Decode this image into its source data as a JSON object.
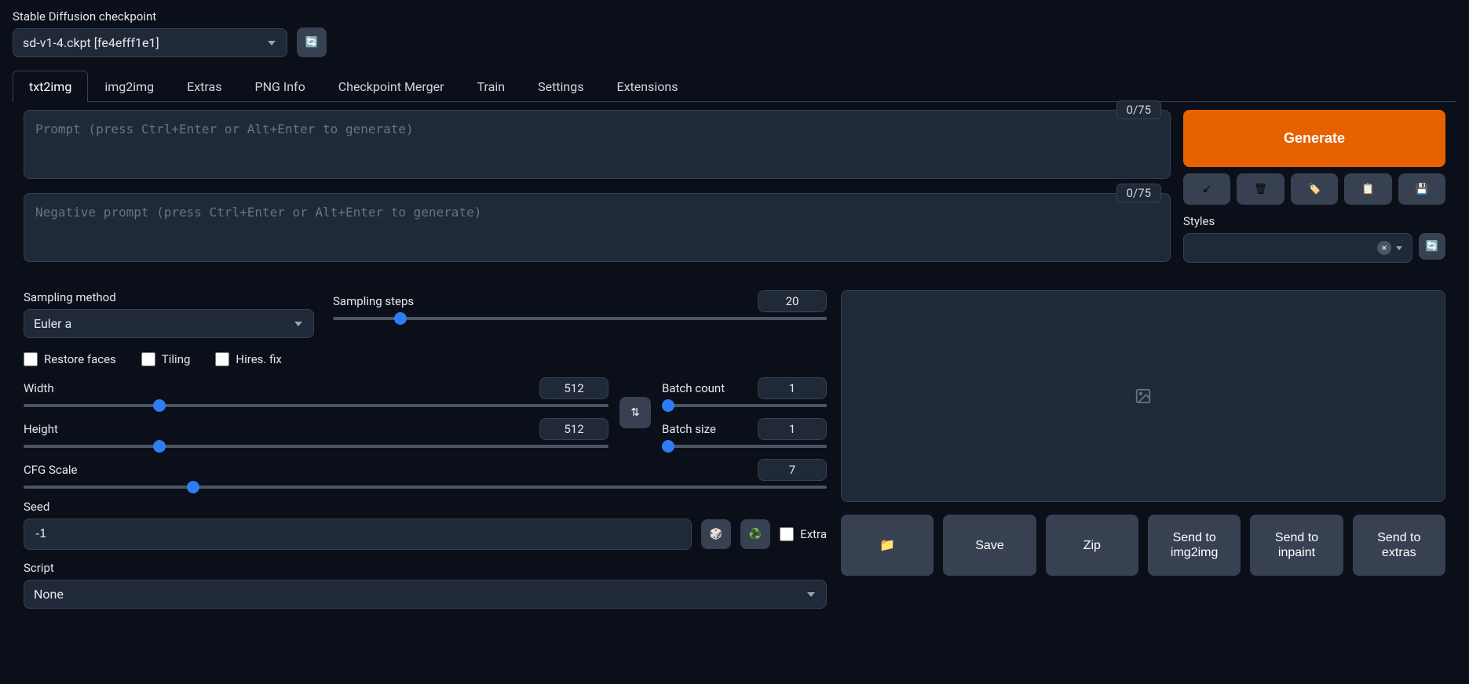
{
  "header": {
    "checkpoint_label": "Stable Diffusion checkpoint",
    "checkpoint_value": "sd-v1-4.ckpt [fe4efff1e1]"
  },
  "tabs": [
    "txt2img",
    "img2img",
    "Extras",
    "PNG Info",
    "Checkpoint Merger",
    "Train",
    "Settings",
    "Extensions"
  ],
  "active_tab": 0,
  "prompt": {
    "placeholder": "Prompt (press Ctrl+Enter or Alt+Enter to generate)",
    "counter": "0/75",
    "neg_placeholder": "Negative prompt (press Ctrl+Enter or Alt+Enter to generate)",
    "neg_counter": "0/75"
  },
  "right": {
    "generate": "Generate",
    "styles_label": "Styles"
  },
  "sampling": {
    "method_label": "Sampling method",
    "method_value": "Euler a",
    "steps_label": "Sampling steps",
    "steps_value": "20"
  },
  "checks": {
    "restore": "Restore faces",
    "tiling": "Tiling",
    "hires": "Hires. fix"
  },
  "dims": {
    "width_label": "Width",
    "width_value": "512",
    "height_label": "Height",
    "height_value": "512"
  },
  "batch": {
    "count_label": "Batch count",
    "count_value": "1",
    "size_label": "Batch size",
    "size_value": "1"
  },
  "cfg": {
    "label": "CFG Scale",
    "value": "7"
  },
  "seed": {
    "label": "Seed",
    "value": "-1",
    "extra": "Extra"
  },
  "script": {
    "label": "Script",
    "value": "None"
  },
  "actions": {
    "folder": "📁",
    "save": "Save",
    "zip": "Zip",
    "send_img2img": "Send to img2img",
    "send_inpaint": "Send to inpaint",
    "send_extras": "Send to extras"
  }
}
